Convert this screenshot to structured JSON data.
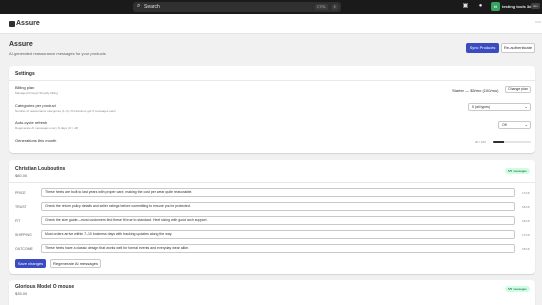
{
  "topbar": {
    "search_label": "Search",
    "shortcut_ctrl": "CTRL",
    "shortcut_key": "K",
    "store_name": "testing tools 3d",
    "store_initials": "tt",
    "store_badge": "dev"
  },
  "app": {
    "title": "Assure",
    "more": "⋯"
  },
  "page": {
    "title": "Assure",
    "subtitle": "AI-generated reassurance messages for your products",
    "primary_action": "Sync Products",
    "secondary_action": "Re-authenticate"
  },
  "settings": {
    "title": "Settings",
    "billing_label": "Billing plan",
    "billing_hint": "Managed through Shopify billing",
    "plan_value": "Starter — $5/mo (100/mo)",
    "change_plan": "Change plan",
    "categories_label": "Categories per product",
    "categories_hint": "Number of reassurance categories (1–5). Productions get 5 messages each",
    "categories_value": "5 (all types)",
    "auto_label": "Auto-cycle refresh",
    "auto_hint": "Regenerate AI messages every N days (0 = off)",
    "auto_value": "Off",
    "gen_label": "Generations this month",
    "gen_count": "30 / 100",
    "gen_fraction": 0.3
  },
  "products": [
    {
      "name": "Christian Louboutins",
      "price": "$80.00",
      "badge": "5/5 messages",
      "fields": [
        {
          "label": "PRICE",
          "value": "These heels are built to last years with proper care, making the cost per wear quite reasonable.",
          "count": "17/18"
        },
        {
          "label": "TRUST",
          "value": "Check the return policy details and seller ratings before committing to ensure you're protected.",
          "count": "18/18"
        },
        {
          "label": "FIT",
          "value": "Check the size guide—most customers find these fit true to standard. Heel sizing with good arch support.",
          "count": "18/18"
        },
        {
          "label": "SHIPPING",
          "value": "Most orders arrive within 7–10 business days with tracking updates along the way.",
          "count": "17/18"
        },
        {
          "label": "OUTCOME",
          "value": "These heels have a classic design that works well for formal events and everyday wear alike.",
          "count": "18/18"
        }
      ],
      "save_label": "Save changes",
      "regen_label": "Regenerate AI messages"
    },
    {
      "name": "Glorious Model O mouse",
      "price": "$35.00",
      "badge": "5/5 messages"
    }
  ]
}
